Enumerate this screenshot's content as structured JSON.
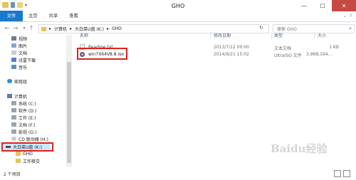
{
  "window": {
    "title": "GHO"
  },
  "ribbon": {
    "tabs": [
      "文件",
      "主页",
      "共享",
      "查看"
    ]
  },
  "address": {
    "segments": [
      "计算机",
      "大白菜U盘 (K:)",
      "GHO"
    ],
    "separator": "▸",
    "search_placeholder": "搜索 GHO"
  },
  "nav": {
    "items": [
      {
        "label": "视频",
        "icon": "video-icon"
      },
      {
        "label": "图片",
        "icon": "pictures-icon"
      },
      {
        "label": "文档",
        "icon": "documents-icon"
      },
      {
        "label": "迅雷下载",
        "icon": "download-icon"
      },
      {
        "label": "音乐",
        "icon": "music-icon"
      },
      {
        "label": "家庭组",
        "icon": "homegroup-icon"
      },
      {
        "label": "计算机",
        "icon": "computer-icon"
      },
      {
        "label": "系统 (C:)",
        "icon": "drive-icon"
      },
      {
        "label": "软件 (D:)",
        "icon": "drive-icon"
      },
      {
        "label": "工作 (E:)",
        "icon": "drive-icon"
      },
      {
        "label": "文档 (F:)",
        "icon": "drive-icon"
      },
      {
        "label": "影视 (G:)",
        "icon": "drive-icon"
      },
      {
        "label": "CD 驱动器 (H:)",
        "icon": "cd-drive-icon"
      },
      {
        "label": "大白菜U盘 (K:)",
        "icon": "usb-drive-icon"
      },
      {
        "label": "GHO",
        "icon": "folder-icon"
      },
      {
        "label": "工作移交",
        "icon": "folder-icon"
      }
    ]
  },
  "columns": [
    "名称",
    "修改日期",
    "类型",
    "大小"
  ],
  "files": [
    {
      "name": "Readme.txt",
      "date": "2013/7/12 00:00",
      "type": "文本文档",
      "size": "1 KB",
      "icon": "text-file-icon"
    },
    {
      "name": "win7X64V8.8.iso",
      "date": "2014/9/21 15:02",
      "type": "UltraISO 文件",
      "size": "3,968,194...",
      "icon": "iso-file-icon"
    }
  ],
  "status": {
    "count": "2 个项目"
  },
  "watermark": "Baidu经验",
  "colors": {
    "accent": "#1979ca",
    "highlight": "#e0201a",
    "selected": "#cce8ff",
    "close": "#c74a42"
  }
}
